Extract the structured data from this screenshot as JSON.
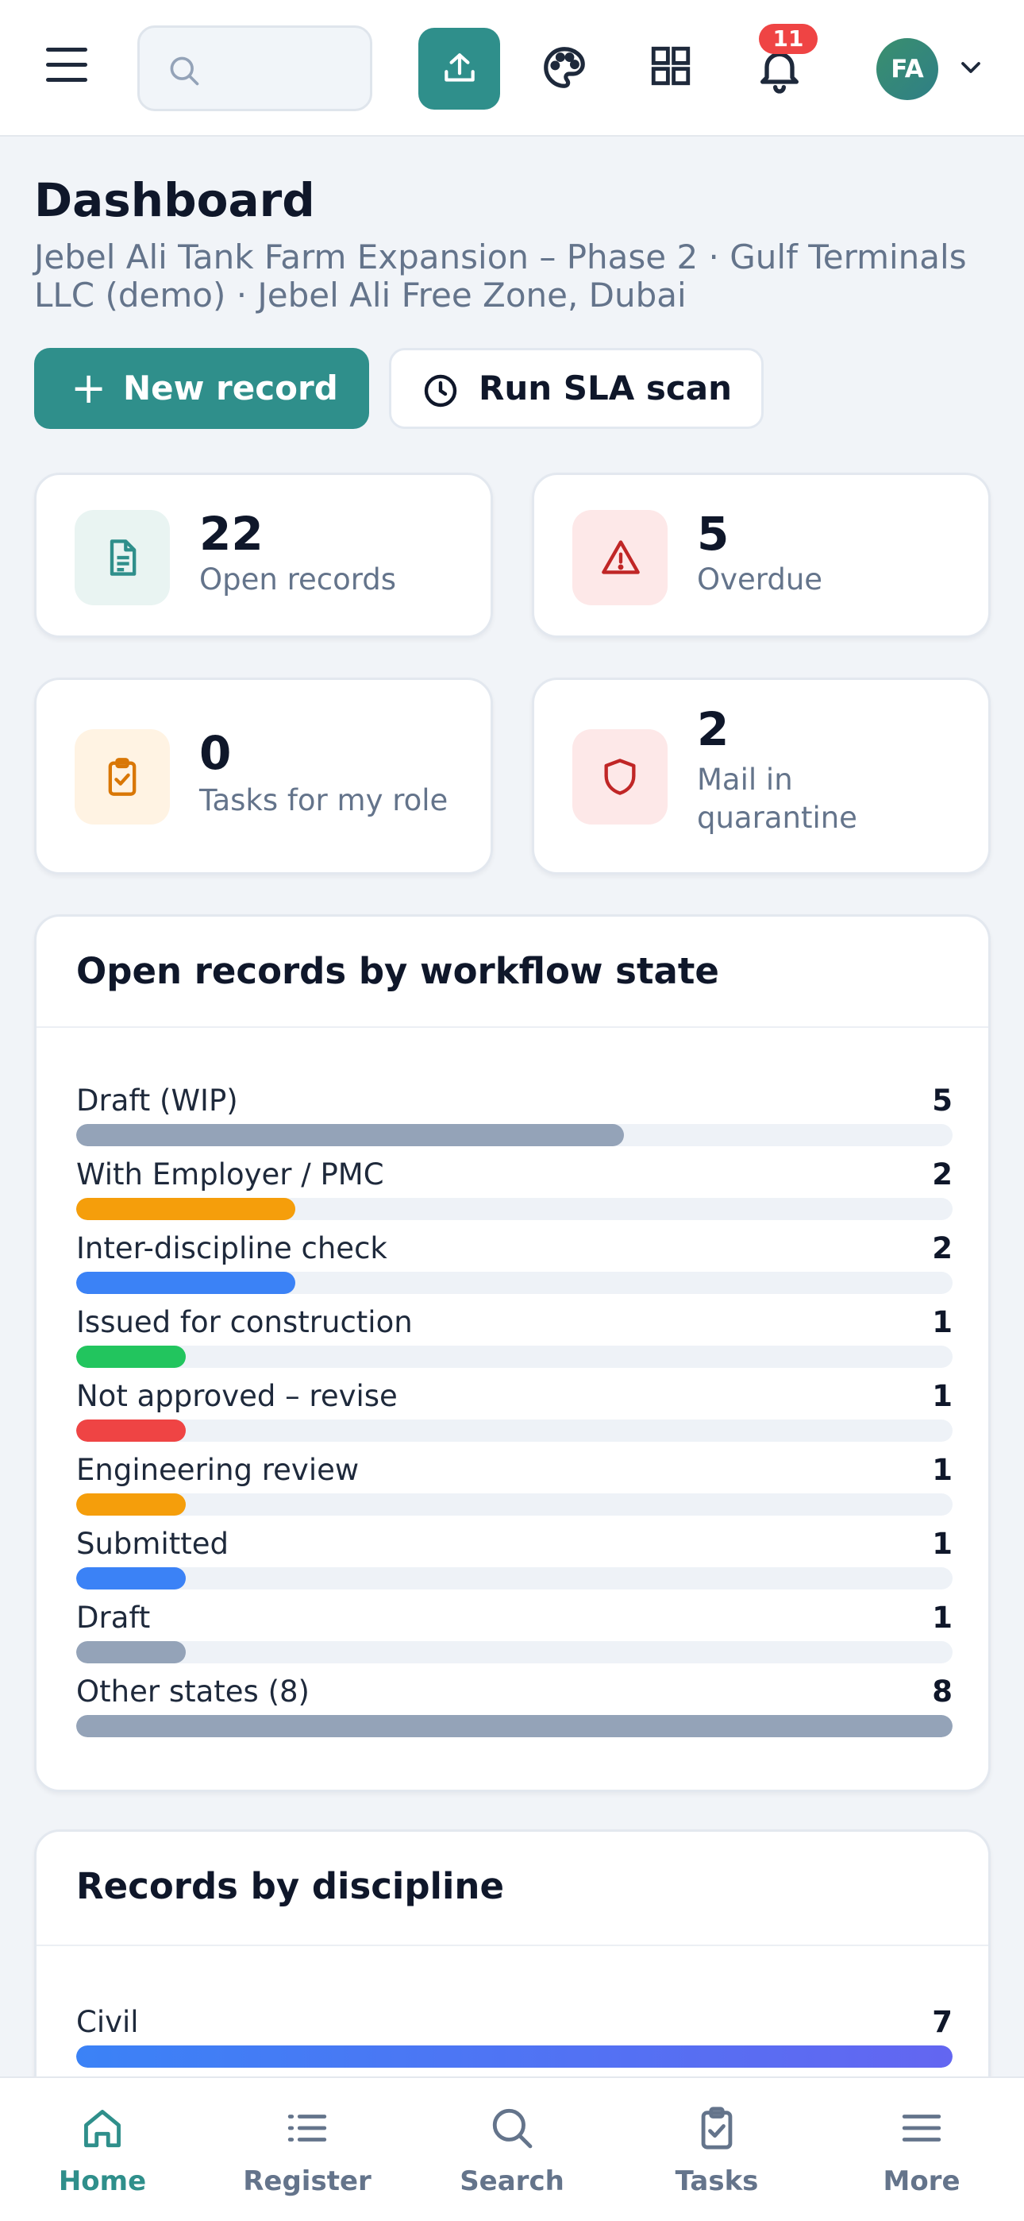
{
  "header": {
    "search_placeholder": "",
    "notification_count": "11",
    "avatar_initials": "FA"
  },
  "page": {
    "title": "Dashboard",
    "subtitle": "Jebel Ali Tank Farm Expansion – Phase 2 · Gulf Terminals LLC (demo) · Jebel Ali Free Zone, Dubai"
  },
  "actions": {
    "new_record": "New record",
    "new_record_icon": "+",
    "run_sla": "Run SLA scan"
  },
  "stats": [
    {
      "value": "22",
      "label": "Open records",
      "icon": "document-icon",
      "color": "#2f8f8b",
      "bg": "#e9f4f2"
    },
    {
      "value": "5",
      "label": "Overdue",
      "icon": "warning-triangle-icon",
      "color": "#c02626",
      "bg": "#fde8e8"
    },
    {
      "value": "0",
      "label": "Tasks for my role",
      "icon": "clipboard-check-icon",
      "color": "#d97706",
      "bg": "#fff3e3"
    },
    {
      "value": "2",
      "label": "Mail in quarantine",
      "icon": "shield-icon",
      "color": "#c02626",
      "bg": "#fde8e8"
    }
  ],
  "workflow_panel": {
    "title": "Open records by workflow state",
    "max": 8,
    "rows": [
      {
        "label": "Draft (WIP)",
        "value": 5,
        "color": "#94a3b8"
      },
      {
        "label": "With Employer / PMC",
        "value": 2,
        "color": "#f59e0b"
      },
      {
        "label": "Inter-discipline check",
        "value": 2,
        "color": "#3b82f6"
      },
      {
        "label": "Issued for construction",
        "value": 1,
        "color": "#22c55e"
      },
      {
        "label": "Not approved – revise",
        "value": 1,
        "color": "#ef4444"
      },
      {
        "label": "Engineering review",
        "value": 1,
        "color": "#f59e0b"
      },
      {
        "label": "Submitted",
        "value": 1,
        "color": "#3b82f6"
      },
      {
        "label": "Draft",
        "value": 1,
        "color": "#94a3b8"
      },
      {
        "label": "Other states (8)",
        "value": 8,
        "color": "#94a3b8"
      }
    ]
  },
  "discipline_panel": {
    "title": "Records by discipline",
    "max": 7,
    "rows": [
      {
        "label": "Civil",
        "value": 7,
        "color": "linear-gradient(90deg,#3b82f6,#6366f1)"
      }
    ]
  },
  "bottom_nav": [
    {
      "label": "Home",
      "icon": "home-icon",
      "active": true
    },
    {
      "label": "Register",
      "icon": "list-icon",
      "active": false
    },
    {
      "label": "Search",
      "icon": "search-icon",
      "active": false
    },
    {
      "label": "Tasks",
      "icon": "clipboard-check-icon",
      "active": false
    },
    {
      "label": "More",
      "icon": "menu-icon",
      "active": false
    }
  ],
  "colors": {
    "accent": "#2f8f8b",
    "danger": "#ef4444",
    "muted_text": "#64748b"
  }
}
